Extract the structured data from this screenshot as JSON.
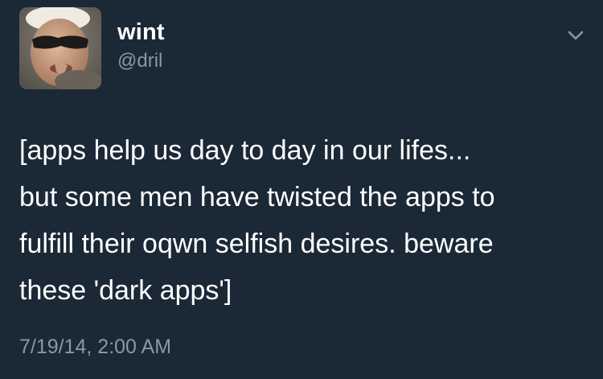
{
  "author": {
    "display_name": "wint",
    "handle": "@dril",
    "avatar_icon": "profile-photo"
  },
  "menu": {
    "icon": "chevron-down-icon"
  },
  "tweet": {
    "lines": [
      "[apps help us day to day in our lifes...",
      "but some men have twisted the apps to",
      "fulfill their oqwn selfish desires. beware",
      "these 'dark apps']"
    ],
    "timestamp": "7/19/14, 2:00 AM"
  },
  "colors": {
    "background": "#1b2836",
    "text_primary": "#ffffff",
    "text_secondary": "#8899a6"
  }
}
